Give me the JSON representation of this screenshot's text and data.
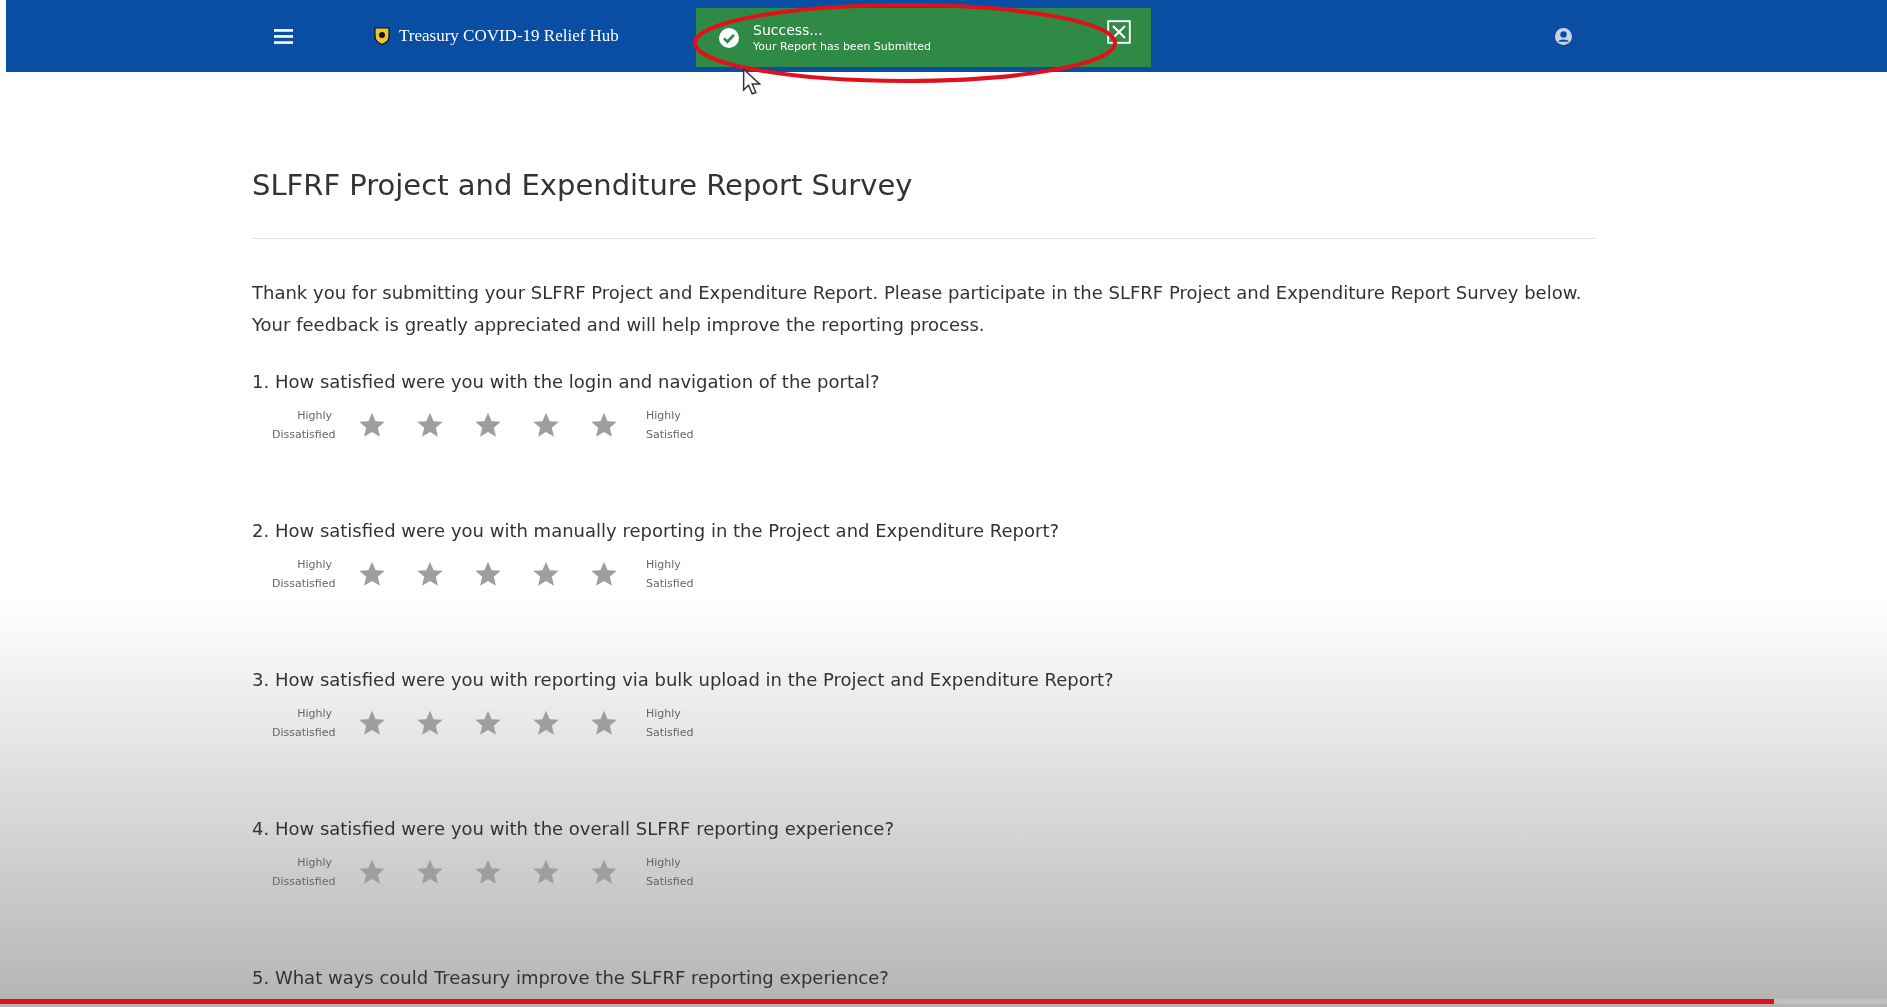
{
  "header": {
    "title": "Treasury COVID-19 Relief Hub"
  },
  "toast": {
    "title": "Success...",
    "message": "Your Report has been Submitted"
  },
  "page": {
    "title": "SLFRF Project and Expenditure Report Survey",
    "intro": "Thank you for submitting your SLFRF Project and Expenditure Report. Please participate in the SLFRF Project and Expenditure Report Survey below. Your feedback is greatly appreciated and will help improve the reporting process."
  },
  "questions": [
    {
      "text": "1. How satisfied were you with the login and navigation of the portal?",
      "low_label": "Highly Dissatisfied",
      "high_label": "Highly Satisfied"
    },
    {
      "text": "2. How satisfied were you with manually reporting in the Project and Expenditure Report?",
      "low_label": "Highly Dissatisfied",
      "high_label": "Highly Satisfied"
    },
    {
      "text": "3. How satisfied were you with reporting via bulk upload in the Project and Expenditure Report?",
      "low_label": "Highly Dissatisfied",
      "high_label": "Highly Satisfied"
    },
    {
      "text": "4. How satisfied were you with the overall SLFRF reporting experience?",
      "low_label": "Highly Dissatisfied",
      "high_label": "Highly Satisfied"
    },
    {
      "text": "5. What ways could Treasury improve the SLFRF reporting experience?"
    }
  ],
  "video_progress": {
    "level": 0.94
  }
}
